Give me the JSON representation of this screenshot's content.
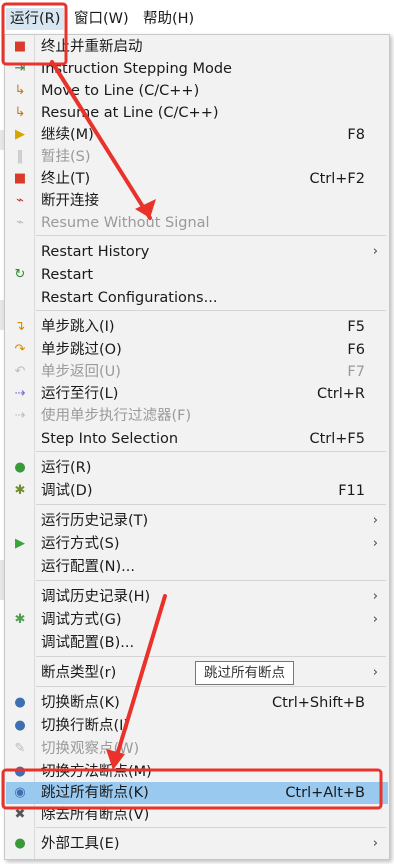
{
  "menubar": {
    "items": [
      "运行(R)",
      "窗口(W)",
      "帮助(H)"
    ]
  },
  "menu": {
    "items": [
      {
        "label": "终止并重新启动",
        "icon": "terminate-relaunch-icon"
      },
      {
        "label": "Instruction Stepping Mode",
        "icon": "instruction-stepping-icon"
      },
      {
        "label": "Move to Line (C/C++)",
        "icon": "move-to-line-icon"
      },
      {
        "label": "Resume at Line (C/C++)",
        "icon": "resume-at-line-icon"
      },
      {
        "label": "继续(M)",
        "shortcut": "F8",
        "icon": "resume-icon"
      },
      {
        "label": "暂挂(S)",
        "icon": "suspend-icon",
        "disabled": true
      },
      {
        "label": "终止(T)",
        "shortcut": "Ctrl+F2",
        "icon": "terminate-icon"
      },
      {
        "label": "断开连接",
        "icon": "disconnect-icon"
      },
      {
        "label": "Resume Without Signal",
        "icon": "resume-without-signal-icon",
        "disabled": true
      },
      {
        "label": "Restart History",
        "submenu": true
      },
      {
        "label": "Restart",
        "icon": "restart-icon"
      },
      {
        "label": "Restart Configurations..."
      },
      {
        "label": "单步跳入(I)",
        "shortcut": "F5",
        "icon": "step-into-icon"
      },
      {
        "label": "单步跳过(O)",
        "shortcut": "F6",
        "icon": "step-over-icon"
      },
      {
        "label": "单步返回(U)",
        "shortcut": "F7",
        "icon": "step-return-icon",
        "disabled": true
      },
      {
        "label": "运行至行(L)",
        "shortcut": "Ctrl+R",
        "icon": "run-to-line-icon"
      },
      {
        "label": "使用单步执行过滤器(F)",
        "icon": "step-filter-icon",
        "disabled": true
      },
      {
        "label": "Step Into Selection",
        "shortcut": "Ctrl+F5"
      },
      {
        "label": "运行(R)",
        "icon": "run-icon"
      },
      {
        "label": "调试(D)",
        "shortcut": "F11",
        "icon": "debug-icon"
      },
      {
        "label": "运行历史记录(T)",
        "submenu": true
      },
      {
        "label": "运行方式(S)",
        "submenu": true,
        "icon": "run-as-icon"
      },
      {
        "label": "运行配置(N)..."
      },
      {
        "label": "调试历史记录(H)",
        "submenu": true
      },
      {
        "label": "调试方式(G)",
        "submenu": true,
        "icon": "debug-as-icon"
      },
      {
        "label": "调试配置(B)..."
      },
      {
        "label": "断点类型(r)",
        "submenu": true
      },
      {
        "label": "切换断点(K)",
        "shortcut": "Ctrl+Shift+B",
        "icon": "toggle-breakpoint-icon"
      },
      {
        "label": "切换行断点(I)",
        "icon": "toggle-line-breakpoint-icon"
      },
      {
        "label": "切换观察点(W)",
        "icon": "toggle-watchpoint-icon",
        "disabled": true
      },
      {
        "label": "切换方法断点(M)",
        "icon": "toggle-method-breakpoint-icon"
      },
      {
        "label": "跳过所有断点(K)",
        "shortcut": "Ctrl+Alt+B",
        "icon": "skip-all-breakpoints-icon",
        "highlighted": true
      },
      {
        "label": "除去所有断点(V)",
        "icon": "remove-all-breakpoints-icon"
      },
      {
        "label": "外部工具(E)",
        "submenu": true,
        "icon": "external-tools-icon"
      }
    ]
  },
  "tooltip": "跳过所有断点",
  "submenu_arrow": "›",
  "colors": {
    "highlight": "#99c9ef",
    "annotation_red": "#e8322a"
  }
}
